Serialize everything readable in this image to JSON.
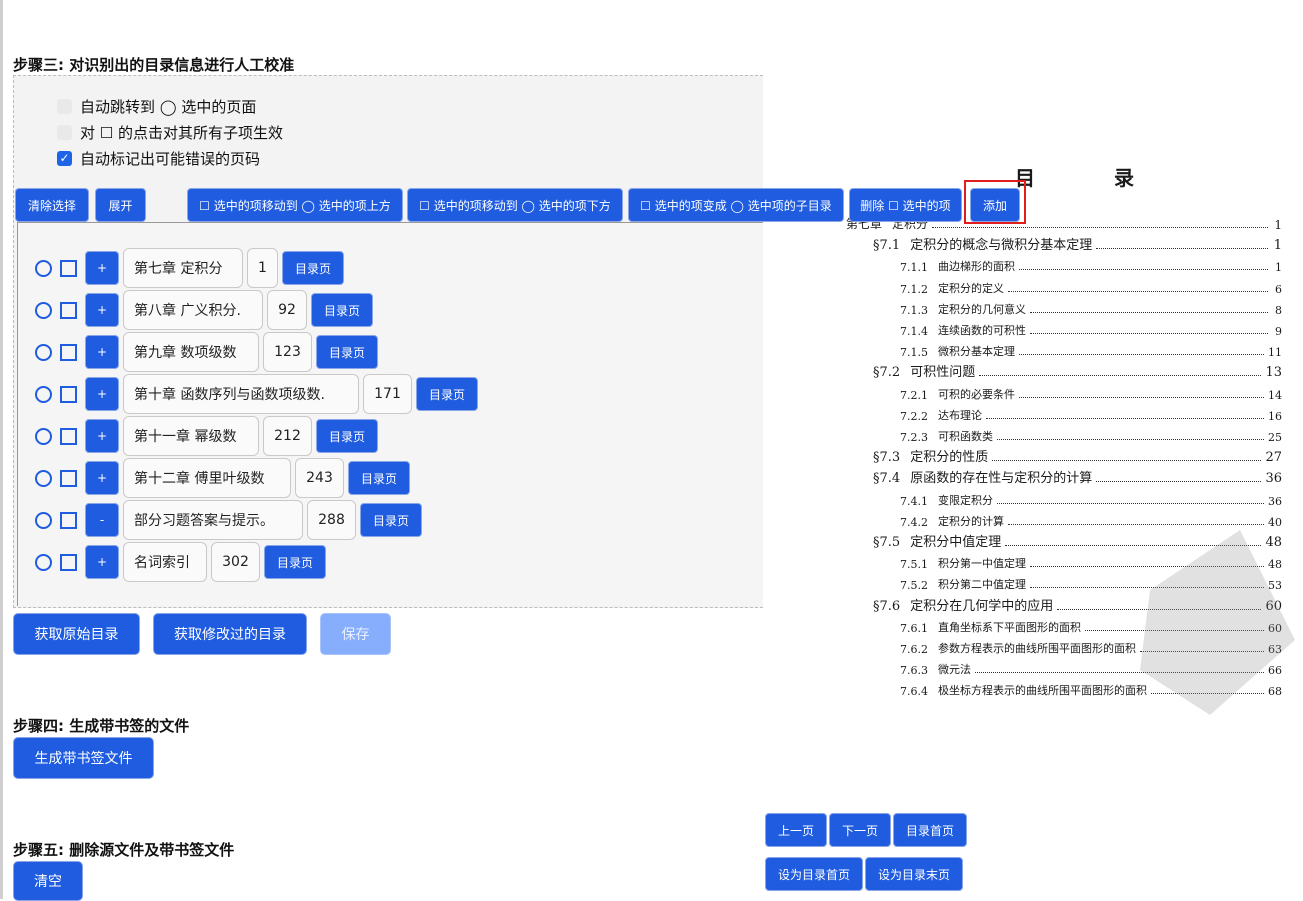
{
  "step3": {
    "title": "步骤三: 对识别出的目录信息进行人工校准",
    "options": [
      {
        "label": "自动跳转到 ◯ 选中的页面",
        "checked": false
      },
      {
        "label": "对 ☐ 的点击对其所有子项生效",
        "checked": false
      },
      {
        "label": "自动标记出可能错误的页码",
        "checked": true
      }
    ],
    "toolbar": {
      "clear": "清除选择",
      "expand": "展开",
      "move_above": "☐ 选中的项移动到 ◯ 选中的项上方",
      "move_below": "☐ 选中的项移动到 ◯ 选中的项下方",
      "make_child": "☐ 选中的项变成 ◯ 选中项的子目录",
      "delete": "删除 ☐ 选中的项",
      "add": "添加"
    },
    "rows": [
      {
        "toggle": "+",
        "title": "第七章 定积分",
        "page": "1",
        "btn": "目录页"
      },
      {
        "toggle": "+",
        "title": "第八章 广义积分.",
        "page": "92",
        "btn": "目录页"
      },
      {
        "toggle": "+",
        "title": "第九章 数项级数",
        "page": "123",
        "btn": "目录页"
      },
      {
        "toggle": "+",
        "title": "第十章 函数序列与函数项级数.",
        "page": "171",
        "btn": "目录页"
      },
      {
        "toggle": "+",
        "title": "第十一章 幂级数",
        "page": "212",
        "btn": "目录页"
      },
      {
        "toggle": "+",
        "title": "第十二章 傅里叶级数",
        "page": "243",
        "btn": "目录页"
      },
      {
        "toggle": "-",
        "title": "部分习题答案与提示。",
        "page": "288",
        "btn": "目录页"
      },
      {
        "toggle": "+",
        "title": "名词索引",
        "page": "302",
        "btn": "目录页"
      }
    ],
    "get_original": "获取原始目录",
    "get_modified": "获取修改过的目录",
    "save": "保存"
  },
  "step4": {
    "title": "步骤四: 生成带书签的文件",
    "generate": "生成带书签文件"
  },
  "step5": {
    "title": "步骤五: 删除源文件及带书签文件",
    "clear": "清空"
  },
  "pager": {
    "prev": "上一页",
    "next": "下一页",
    "toc_home": "目录首页",
    "set_first": "设为目录首页",
    "set_last": "设为目录末页"
  },
  "scan": {
    "title": "目 录",
    "entries": [
      {
        "level": 0,
        "num": "第七章",
        "text": "定积分",
        "page": "1"
      },
      {
        "level": 1,
        "num": "§7.1",
        "text": "定积分的概念与微积分基本定理",
        "page": "1"
      },
      {
        "level": 2,
        "num": "7.1.1",
        "text": "曲边梯形的面积",
        "page": "1"
      },
      {
        "level": 2,
        "num": "7.1.2",
        "text": "定积分的定义",
        "page": "6"
      },
      {
        "level": 2,
        "num": "7.1.3",
        "text": "定积分的几何意义",
        "page": "8"
      },
      {
        "level": 2,
        "num": "7.1.4",
        "text": "连续函数的可积性",
        "page": "9"
      },
      {
        "level": 2,
        "num": "7.1.5",
        "text": "微积分基本定理",
        "page": "11"
      },
      {
        "level": 1,
        "num": "§7.2",
        "text": "可积性问题",
        "page": "13"
      },
      {
        "level": 2,
        "num": "7.2.1",
        "text": "可积的必要条件",
        "page": "14"
      },
      {
        "level": 2,
        "num": "7.2.2",
        "text": "达布理论",
        "page": "16"
      },
      {
        "level": 2,
        "num": "7.2.3",
        "text": "可积函数类",
        "page": "25"
      },
      {
        "level": 1,
        "num": "§7.3",
        "text": "定积分的性质",
        "page": "27"
      },
      {
        "level": 1,
        "num": "§7.4",
        "text": "原函数的存在性与定积分的计算",
        "page": "36"
      },
      {
        "level": 2,
        "num": "7.4.1",
        "text": "变限定积分",
        "page": "36"
      },
      {
        "level": 2,
        "num": "7.4.2",
        "text": "定积分的计算",
        "page": "40"
      },
      {
        "level": 1,
        "num": "§7.5",
        "text": "定积分中值定理",
        "page": "48"
      },
      {
        "level": 2,
        "num": "7.5.1",
        "text": "积分第一中值定理",
        "page": "48"
      },
      {
        "level": 2,
        "num": "7.5.2",
        "text": "积分第二中值定理",
        "page": "53"
      },
      {
        "level": 1,
        "num": "§7.6",
        "text": "定积分在几何学中的应用",
        "page": "60"
      },
      {
        "level": 2,
        "num": "7.6.1",
        "text": "直角坐标系下平面图形的面积",
        "page": "60"
      },
      {
        "level": 2,
        "num": "7.6.2",
        "text": "参数方程表示的曲线所围平面图形的面积",
        "page": "63"
      },
      {
        "level": 2,
        "num": "7.6.3",
        "text": "微元法",
        "page": "66"
      },
      {
        "level": 2,
        "num": "7.6.4",
        "text": "极坐标方程表示的曲线所围平面图形的面积",
        "page": "68"
      }
    ]
  },
  "colors": {
    "primary": "#1f5ce0",
    "disabled": "#86aefc",
    "highlight": "#e01c1c"
  }
}
